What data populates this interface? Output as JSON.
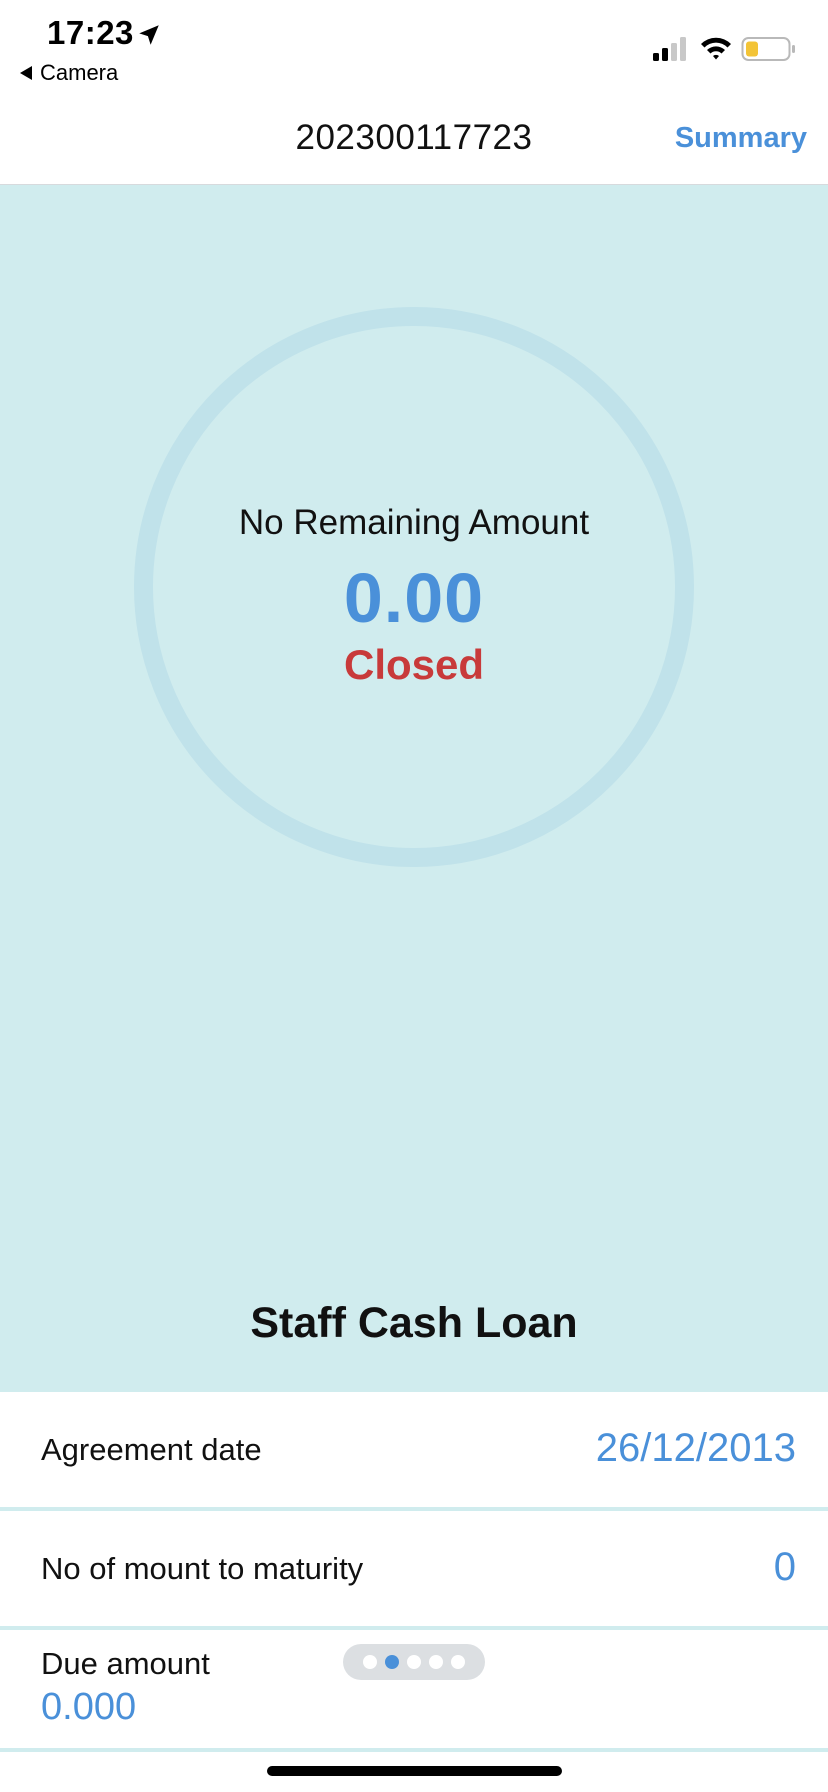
{
  "status_bar": {
    "time": "17:23",
    "back_app": "Camera",
    "icons": [
      "location-arrow-icon",
      "signal-icon",
      "wifi-icon",
      "battery-icon"
    ],
    "battery_color": "#f3c437"
  },
  "nav": {
    "title": "202300117723",
    "summary_label": "Summary"
  },
  "hero": {
    "ring_label": "No Remaining Amount",
    "ring_amount": "0.00",
    "ring_status": "Closed",
    "product_name": "Staff Cash Loan"
  },
  "details": {
    "agreement_date": {
      "label": "Agreement date",
      "value": "26/12/2013"
    },
    "months_to_maturity": {
      "label": "No of mount to maturity",
      "value": "0"
    },
    "due_amount": {
      "label": "Due amount",
      "value": "0.000"
    }
  },
  "pager": {
    "count": 5,
    "active_index": 1
  },
  "colors": {
    "accent": "#4a90d9",
    "hero_background": "#d0ecee",
    "ring": "#c0e2ea",
    "status_closed": "#c83a3a"
  }
}
